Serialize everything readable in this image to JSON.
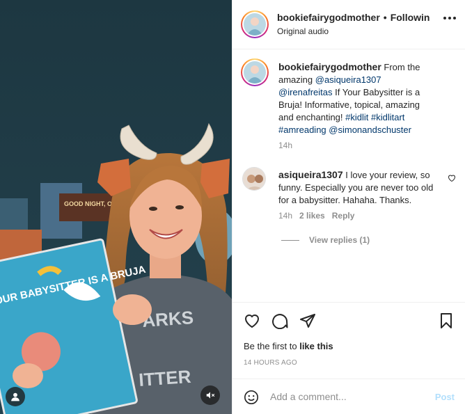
{
  "post": {
    "username": "bookiefairygodmother",
    "separator": "•",
    "follow_label": "Following",
    "audio_label": "Original audio"
  },
  "caption": {
    "username": "bookiefairygodmother",
    "text_1": " From the amazing ",
    "mention_1": "@asiqueira1307",
    "mention_2": "@irenafreitas",
    "text_2": " If Your Babysitter is a Bruja! Informative, topical, amazing and enchanting! ",
    "tag_1": "#kidlit",
    "tag_2": "#kidlitart",
    "tag_3": "#amreading",
    "mention_3": "@simonandschuster",
    "time": "14h"
  },
  "comment": {
    "username": "asiqueira1307",
    "text": " I love your review, so funny. Especially you are never too old for a babysitter. Hahaha. Thanks.",
    "time": "14h",
    "likes": "2 likes",
    "reply_label": "Reply",
    "view_replies": "View replies (1)"
  },
  "footer": {
    "likes_prefix": "Be the first to ",
    "likes_action": "like this",
    "timestamp": "14 HOURS AGO",
    "comment_placeholder": "Add a comment...",
    "post_label": "Post"
  },
  "book": {
    "cover_text": "YOUR BABYSITTER IS A BRUJA",
    "back_book": "GOOD NIGHT, OPPY!"
  },
  "icons": [
    "more-icon",
    "heart-icon",
    "comment-icon",
    "share-icon",
    "bookmark-icon",
    "emoji-icon",
    "user-tag-icon",
    "mute-icon"
  ],
  "colors": {
    "link": "#00376b",
    "muted": "#8e8e8e",
    "post_disabled": "#b2dffc",
    "wall": "#1e3a45"
  }
}
